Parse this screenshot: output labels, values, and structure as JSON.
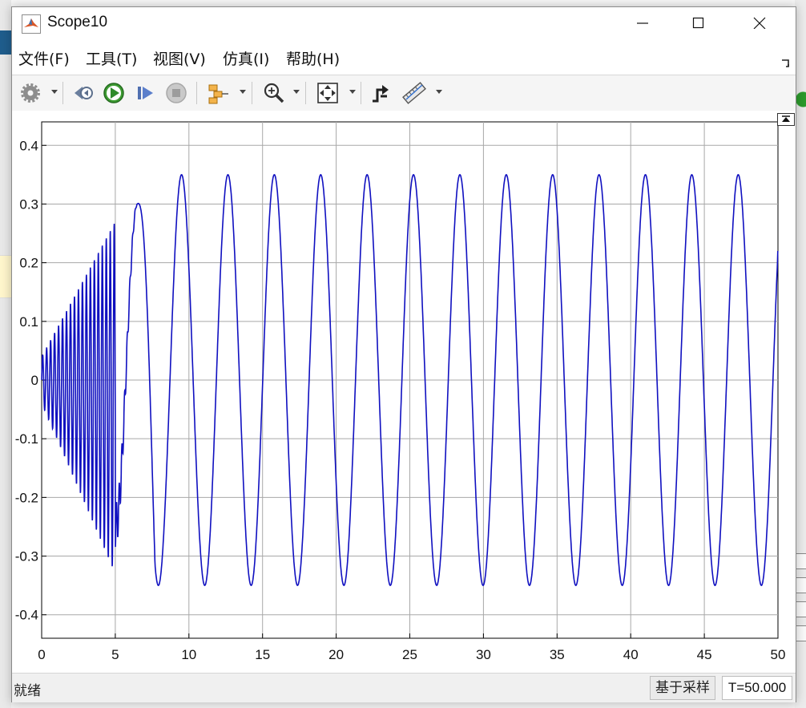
{
  "window": {
    "title": "Scope10"
  },
  "menu": [
    {
      "id": "file",
      "label": "文件(F)"
    },
    {
      "id": "tools",
      "label": "工具(T)"
    },
    {
      "id": "view",
      "label": "视图(V)"
    },
    {
      "id": "simulation",
      "label": "仿真(I)"
    },
    {
      "id": "help",
      "label": "帮助(H)"
    }
  ],
  "toolbar": {
    "icons": [
      "gear-icon",
      "step-back-icon",
      "run-icon",
      "step-forward-icon",
      "stop-icon",
      "signal-highlight-icon",
      "zoom-icon",
      "fit-axes-icon",
      "triggers-icon",
      "measurements-icon"
    ]
  },
  "status": {
    "state": "就绪",
    "mode": "基于采样",
    "time": "T=50.000"
  },
  "colors": {
    "signal": "#1010c0",
    "grid": "#a8a8a8"
  },
  "chart_data": {
    "type": "line",
    "xlim": [
      0,
      50
    ],
    "ylim": [
      -0.44,
      0.44
    ],
    "xticks": [
      0,
      5,
      10,
      15,
      20,
      25,
      30,
      35,
      40,
      45,
      50
    ],
    "yticks": [
      0.4,
      0.3,
      0.2,
      0.1,
      0,
      -0.1,
      -0.2,
      -0.3,
      -0.4
    ],
    "grid": true,
    "series": [
      {
        "description_of_shape": "transient",
        "steady_amplitude": 0.35,
        "steady_period": 3.15,
        "transient": [
          {
            "t_start": 0,
            "t_end": 5,
            "envelope_start": 0.04,
            "envelope_end": 0.3,
            "period": 0.27
          },
          {
            "t_start": 5,
            "t_end": 6.5,
            "mean_start": -0.25,
            "mean_end": 0.3
          }
        ],
        "peak_times": [
          6.5,
          9.5,
          12.65,
          15.8,
          18.95,
          22.1,
          25.25,
          28.4,
          31.55,
          34.7,
          37.85,
          41.0,
          44.15,
          47.3
        ],
        "trough_times": [
          8.0,
          11.1,
          14.25,
          17.4,
          20.55,
          23.7,
          26.85,
          30.0,
          33.15,
          36.3,
          39.45,
          42.6,
          45.75,
          48.9
        ],
        "end_value": 0.22
      }
    ]
  }
}
